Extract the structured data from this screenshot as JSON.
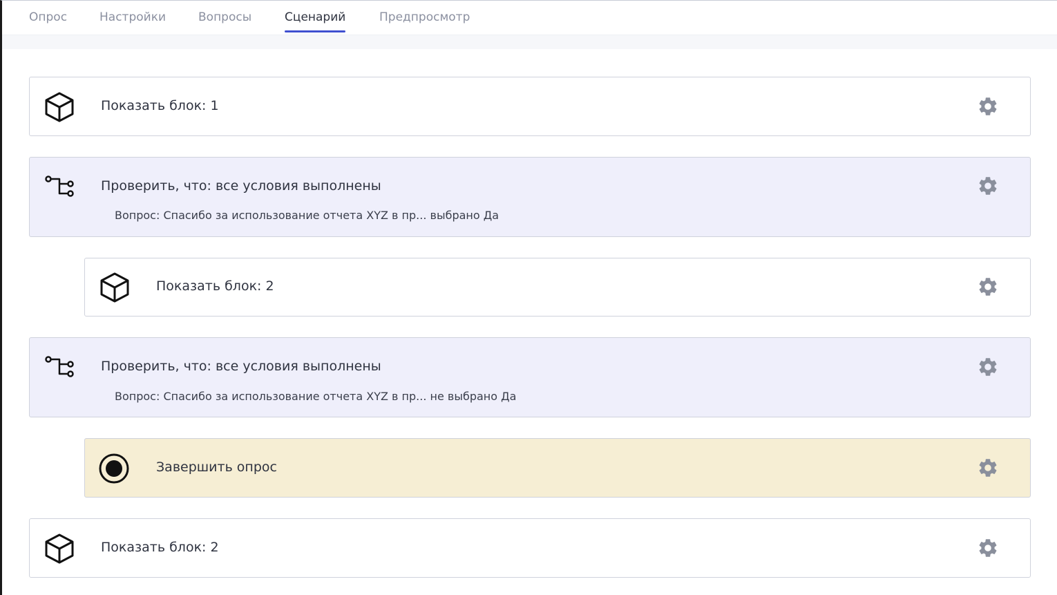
{
  "tabs": [
    {
      "label": "Опрос"
    },
    {
      "label": "Настройки"
    },
    {
      "label": "Вопросы"
    },
    {
      "label": "Сценарий",
      "active": true
    },
    {
      "label": "Предпросмотр"
    }
  ],
  "scenario": [
    {
      "type": "block",
      "title": "Показать блок: 1"
    },
    {
      "type": "condition",
      "title": "Проверить, что: все условия выполнены",
      "subtitle": "Вопрос: Спасибо за использование отчета XYZ в пр... выбрано Да"
    },
    {
      "type": "block",
      "title": "Показать блок: 2"
    },
    {
      "type": "condition",
      "title": "Проверить, что: все условия выполнены",
      "subtitle": "Вопрос: Спасибо за использование отчета XYZ в пр... не выбрано Да"
    },
    {
      "type": "end",
      "title": "Завершить опрос"
    },
    {
      "type": "block",
      "title": "Показать блок: 2"
    }
  ],
  "icons": {
    "block": "cube-icon",
    "condition": "branch-icon",
    "end": "radio-stop-icon",
    "settings": "gear-icon"
  },
  "colors": {
    "tab_active_underline": "#3f4fd0",
    "condition_bg": "#efeffb",
    "end_bg": "#f6eed4",
    "gear": "#8a8f9c"
  }
}
